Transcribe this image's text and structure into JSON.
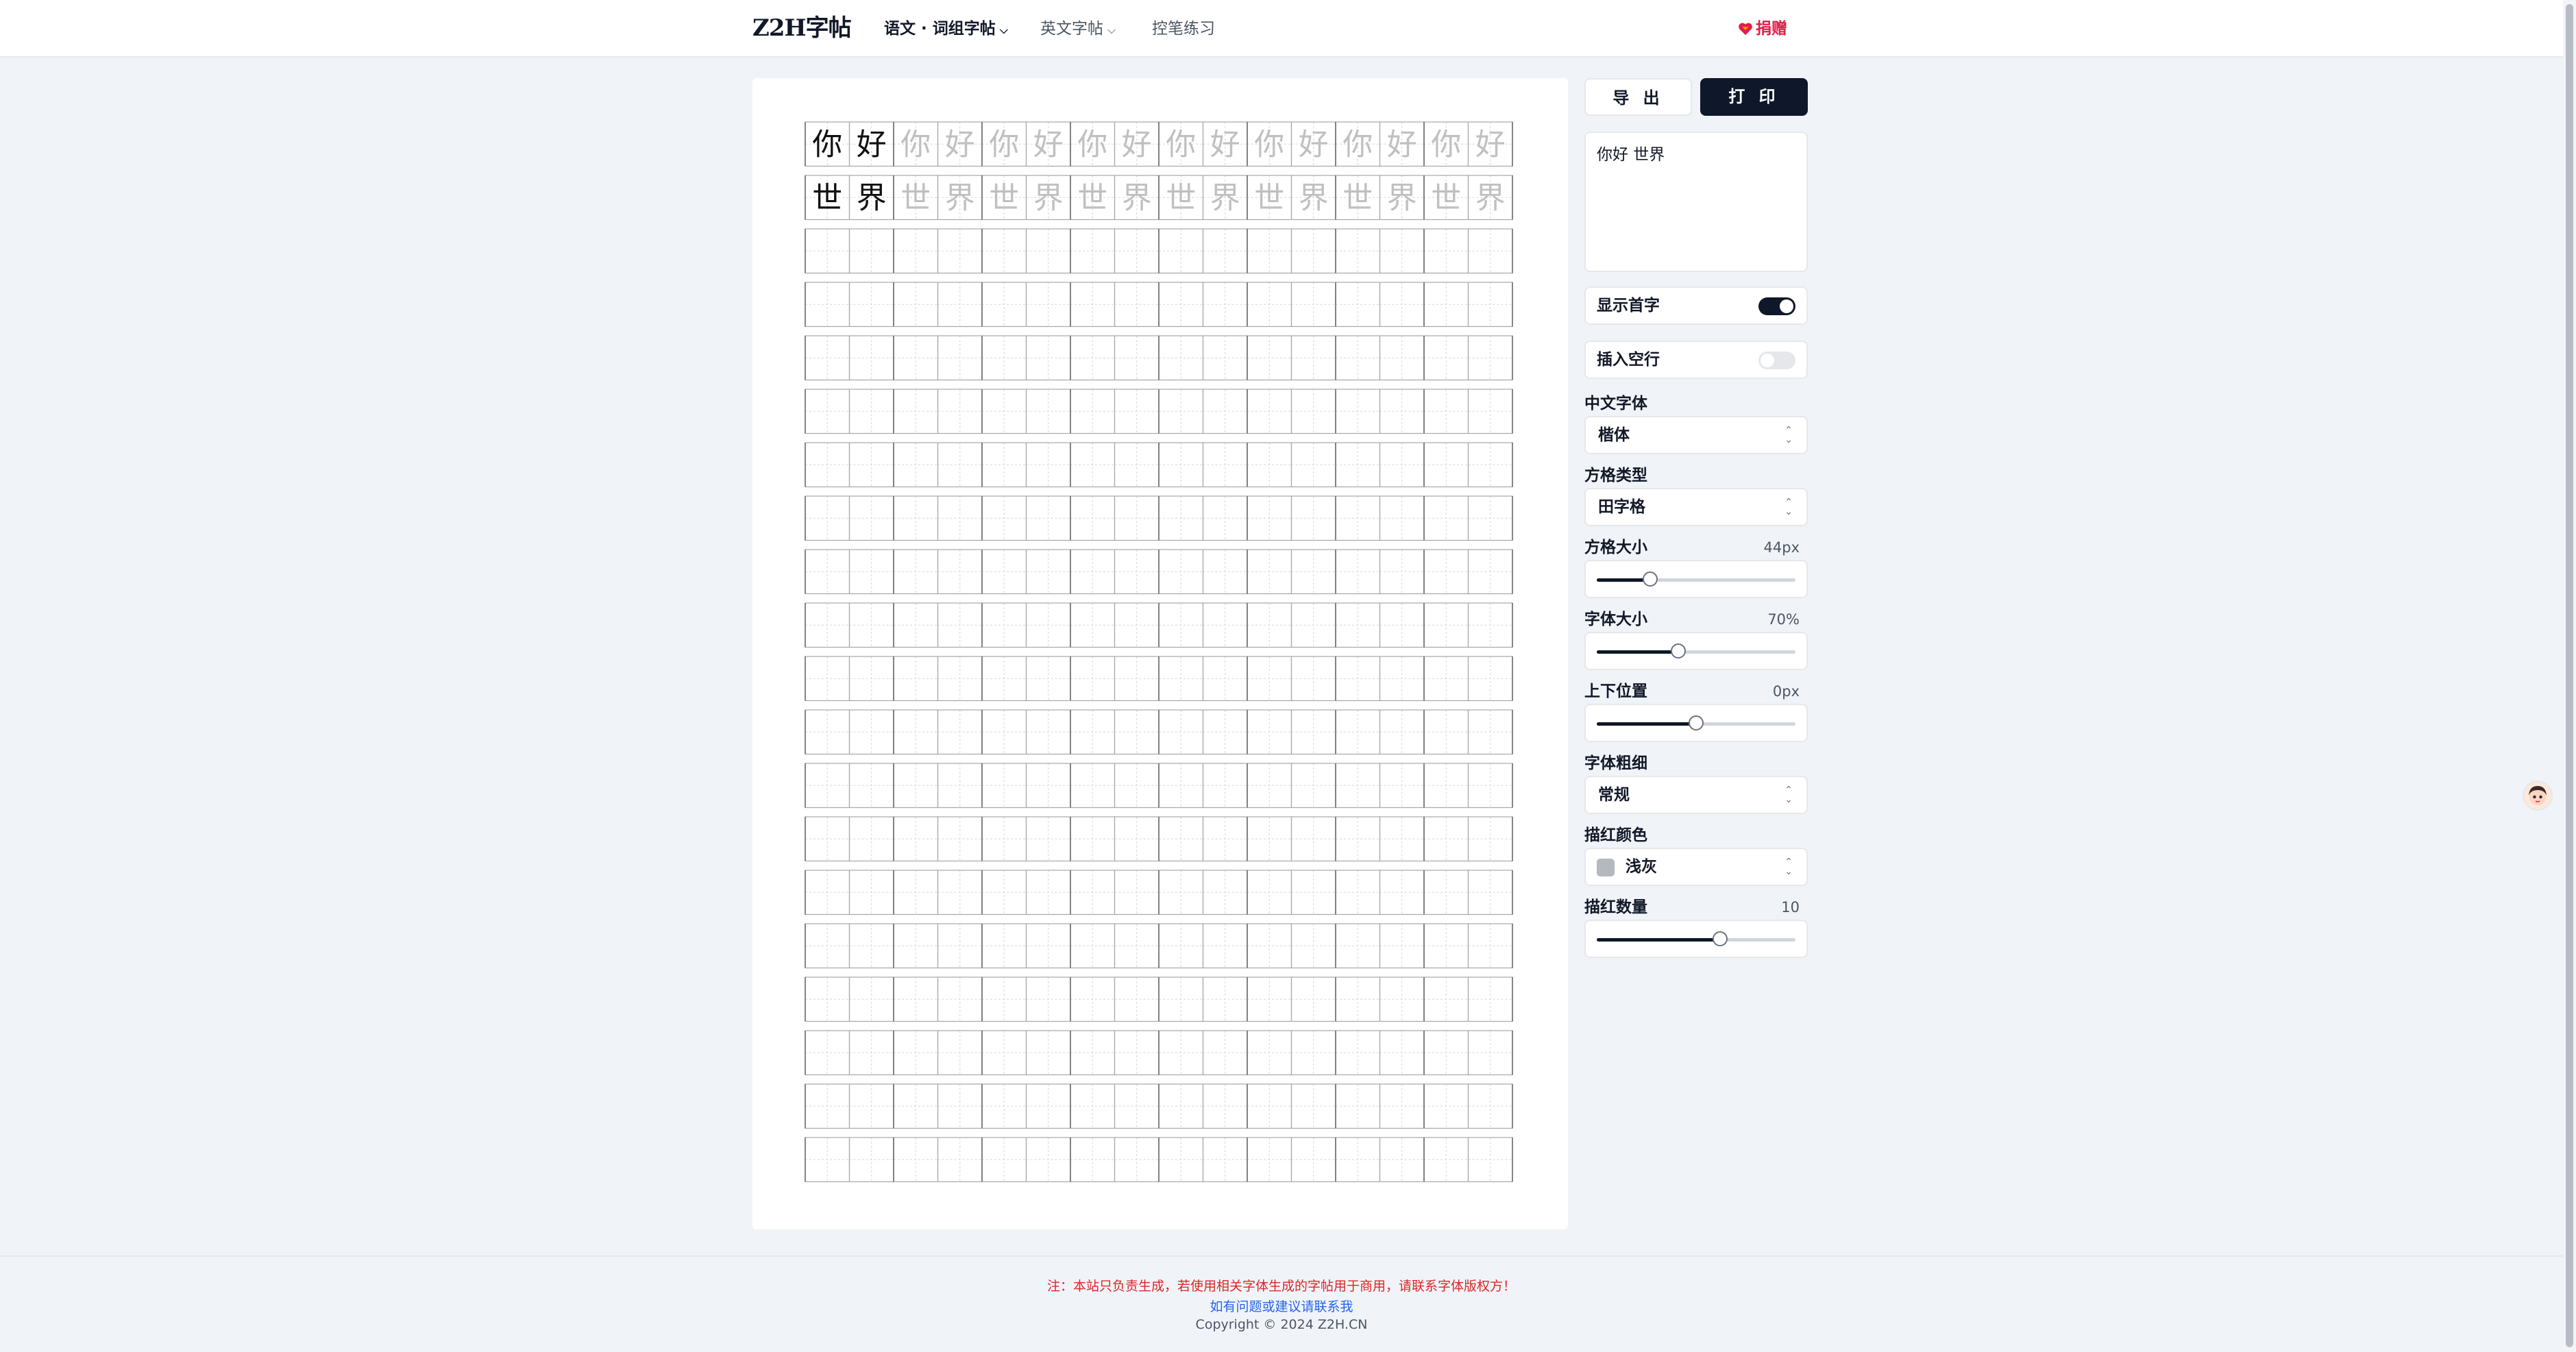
{
  "header": {
    "logo": "Z2H字帖",
    "nav": [
      {
        "label": "语文 · 词组字帖",
        "active": true,
        "dropdown": true
      },
      {
        "label": "英文字帖",
        "active": false,
        "dropdown": true
      },
      {
        "label": "控笔练习",
        "active": false,
        "dropdown": false
      }
    ],
    "donate_label": "捐赠"
  },
  "worksheet": {
    "rows": [
      {
        "chars": [
          "你",
          "好"
        ]
      },
      {
        "chars": [
          "世",
          "界"
        ]
      }
    ],
    "columns": 16,
    "total_rows": 20,
    "trace_count": 10,
    "show_first_char": true,
    "trace_color": "#c0c0c0"
  },
  "controls": {
    "export_label": "导 出",
    "print_label": "打 印",
    "text_input": "你好 世界",
    "show_first_label": "显示首字",
    "show_first_on": true,
    "insert_blank_label": "插入空行",
    "insert_blank_on": false,
    "font_label": "中文字体",
    "font_value": "楷体",
    "grid_type_label": "方格类型",
    "grid_type_value": "田字格",
    "grid_size_label": "方格大小",
    "grid_size_value": "44px",
    "grid_size_fraction": 0.27,
    "font_size_label": "字体大小",
    "font_size_value": "70%",
    "font_size_fraction": 0.41,
    "vertical_pos_label": "上下位置",
    "vertical_pos_value": "0px",
    "vertical_pos_fraction": 0.5,
    "weight_label": "字体粗细",
    "weight_value": "常规",
    "trace_color_label": "描红颜色",
    "trace_color_value": "浅灰",
    "trace_color_hex": "#b4b8bf",
    "trace_count_label": "描红数量",
    "trace_count_value": "10",
    "trace_count_fraction": 0.62
  },
  "footer": {
    "notice": "注：本站只负责生成，若使用相关字体生成的字帖用于商用，请联系字体版权方！",
    "contact": "如有问题或建议请联系我",
    "copyright": "Copyright © 2024 Z2H.CN"
  },
  "colors": {
    "accent": "#0f172a",
    "danger": "#dc2626",
    "link": "#2563eb"
  }
}
